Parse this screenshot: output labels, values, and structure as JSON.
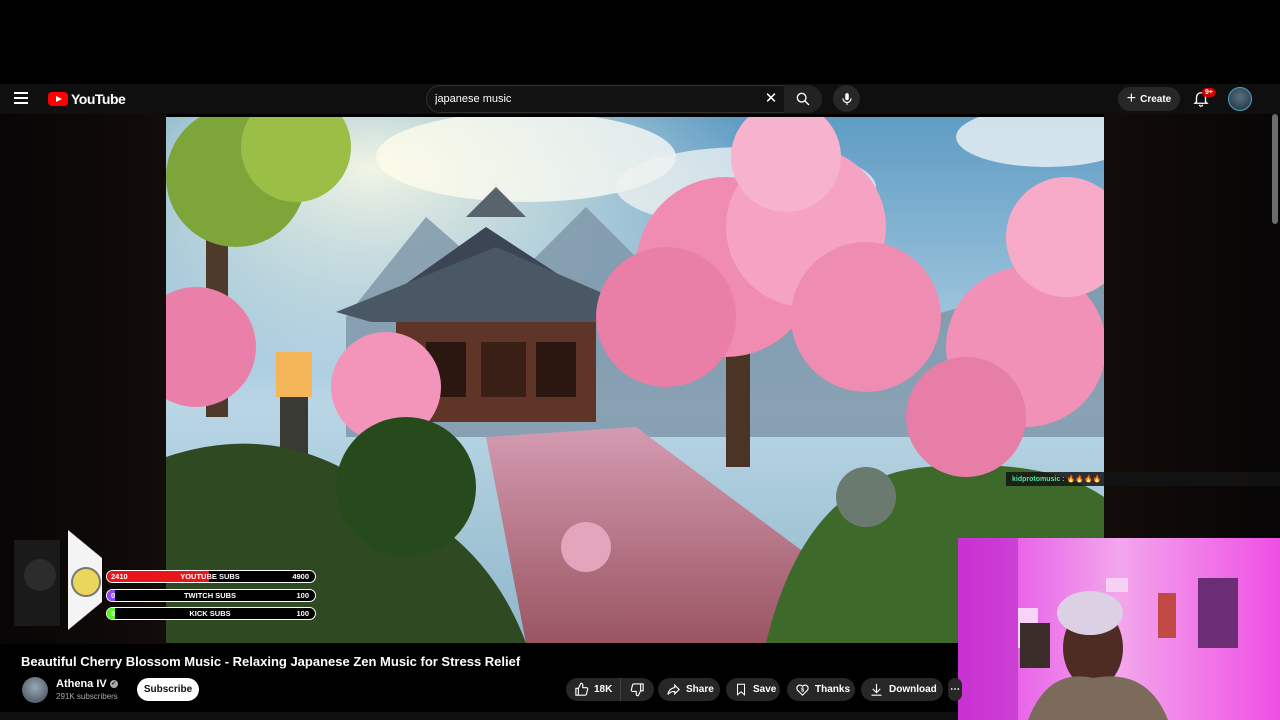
{
  "header": {
    "logo_text": "YouTube",
    "search_value": "japanese music",
    "create_label": "Create",
    "notifications_badge": "9+"
  },
  "video": {
    "title": "Beautiful Cherry Blossom Music - Relaxing Japanese Zen Music for Stress Relief"
  },
  "channel": {
    "name": "Athena IV",
    "subscribers": "291K subscribers",
    "subscribe_label": "Subscribe"
  },
  "actions": {
    "likes": "18K",
    "share": "Share",
    "save": "Save",
    "thanks": "Thanks",
    "download": "Download"
  },
  "overlay": {
    "chat_user": "kidprotomusic :",
    "chat_message": "🔥🔥🔥🔥",
    "sub_goals": [
      {
        "current": "2410",
        "label": "YOUTUBE SUBS",
        "goal": "4900",
        "progress": 0.49,
        "color": "#e8151b"
      },
      {
        "current": "0",
        "label": "TWITCH SUBS",
        "goal": "100",
        "progress": 0.04,
        "color": "#9146ff"
      },
      {
        "current": "0",
        "label": "KICK SUBS",
        "goal": "100",
        "progress": 0.04,
        "color": "#53fc18"
      }
    ]
  },
  "colors": {
    "brand_red": "#ff0000",
    "background": "#0f0f0f",
    "pill": "#272727"
  }
}
